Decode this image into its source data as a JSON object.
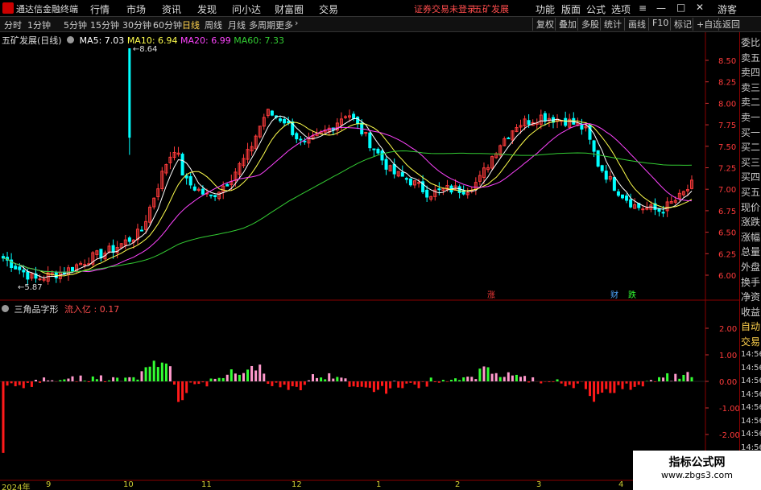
{
  "titlebar": {
    "app": "通达信金融终端",
    "menu": [
      "行情",
      "市场",
      "资讯",
      "发现",
      "问小达",
      "财富圈",
      "交易"
    ],
    "alert": "证券交易未登录",
    "stock": "五矿发展",
    "right": [
      "功能",
      "版面",
      "公式",
      "选项"
    ],
    "guest": "游客"
  },
  "toolbar": {
    "timeframes": [
      "分时",
      "1分钟",
      "5分钟",
      "15分钟",
      "30分钟",
      "60分钟",
      "日线",
      "周线",
      "月线",
      "多周期",
      "更多"
    ],
    "active": "日线",
    "right": [
      "复权",
      "叠加",
      "多股",
      "统计",
      "画线",
      "F10",
      "标记",
      "+自选",
      "返回"
    ]
  },
  "kline": {
    "name": "五矿发展(日线)",
    "ma5": "MA5: 7.03",
    "ma10": "MA10: 6.94",
    "ma20": "MA20: 6.99",
    "ma60": "MA60: 7.33",
    "high_label": "8.64",
    "low_label": "5.87",
    "yticks": [
      "8.50",
      "8.25",
      "8.00",
      "7.75",
      "7.50",
      "7.25",
      "7.00",
      "6.75",
      "6.50",
      "6.25",
      "6.00"
    ]
  },
  "markers": {
    "zhang": "涨",
    "cai": "财",
    "die": "跌"
  },
  "indicator": {
    "name": "三角品字形",
    "label": "流入亿",
    "value": "0.17",
    "yticks": [
      "2.00",
      "1.00",
      "0.00",
      "-1.00",
      "-2.00"
    ]
  },
  "side": {
    "items": [
      "委比",
      "卖五",
      "卖四",
      "卖三",
      "卖二",
      "卖一",
      "买一",
      "买二",
      "买三",
      "买四",
      "买五",
      "现价",
      "涨跌",
      "涨幅",
      "总量",
      "外盘",
      "换手",
      "净资",
      "收益",
      "自动",
      "交易"
    ],
    "times": [
      "14:56",
      "14:56",
      "14:56",
      "14:56",
      "14:56",
      "14:56",
      "14:56",
      "14:56"
    ]
  },
  "dates": {
    "year": "2024年",
    "months": [
      "9",
      "10",
      "11",
      "12",
      "1",
      "2",
      "3",
      "4"
    ]
  },
  "watermark": {
    "line1": "指标公式网",
    "line2": "www.zbgs3.com"
  },
  "colors": {
    "up": "#ff3b3b",
    "down": "#00ffff",
    "ma5": "#ffffff",
    "ma10": "#ffff4d",
    "ma20": "#ff44ff",
    "ma60": "#33cc33",
    "pink": "#ff99cc",
    "green": "#33ff33",
    "red": "#ff1a1a"
  }
}
